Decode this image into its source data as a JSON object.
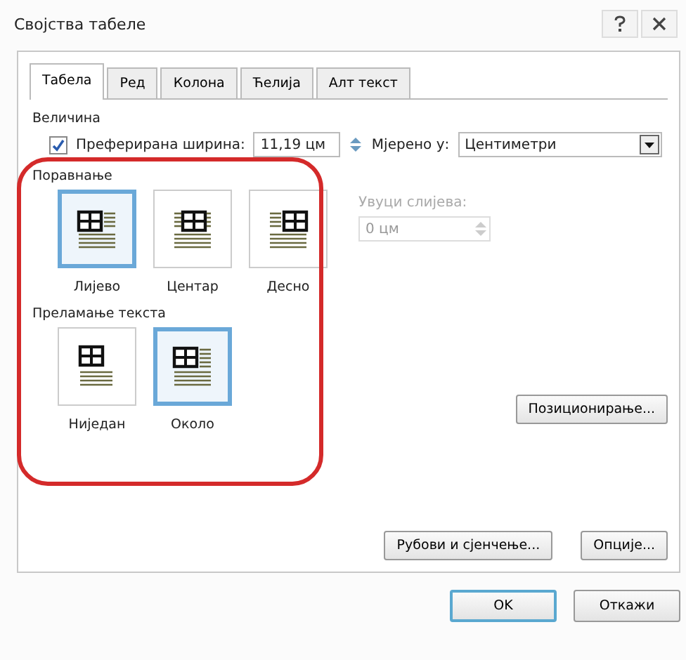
{
  "window": {
    "title": "Својства табеле"
  },
  "tabs": [
    {
      "label": "Табела",
      "selected": true
    },
    {
      "label": "Ред",
      "selected": false
    },
    {
      "label": "Колона",
      "selected": false
    },
    {
      "label": "Ћелија",
      "selected": false
    },
    {
      "label": "Алт текст",
      "selected": false
    }
  ],
  "size": {
    "heading": "Величина",
    "preferred_width": {
      "label": "Преферирана ширина:",
      "checked": true,
      "value": "11,19 цм"
    },
    "measure_in": {
      "label": "Мјерено у:",
      "value": "Центиметри"
    }
  },
  "alignment": {
    "heading": "Поравнање",
    "options": [
      {
        "kind": "left",
        "label": "Лијево",
        "selected": true
      },
      {
        "kind": "center",
        "label": "Центар",
        "selected": false
      },
      {
        "kind": "right",
        "label": "Десно",
        "selected": false
      }
    ],
    "indent": {
      "label": "Увуци слијева:",
      "value": "0 цм",
      "disabled": true
    }
  },
  "text_wrapping": {
    "heading": "Преламање текста",
    "options": [
      {
        "kind": "none",
        "label": "Ниједан",
        "selected": false
      },
      {
        "kind": "around",
        "label": "Около",
        "selected": true
      }
    ],
    "positioning_button": "Позиционирање..."
  },
  "panel_buttons": [
    "Рубови и сјенчење...",
    "Опције..."
  ],
  "buttons": [
    {
      "label": "OK",
      "default": true
    },
    {
      "label": "Откажи",
      "default": false
    }
  ]
}
